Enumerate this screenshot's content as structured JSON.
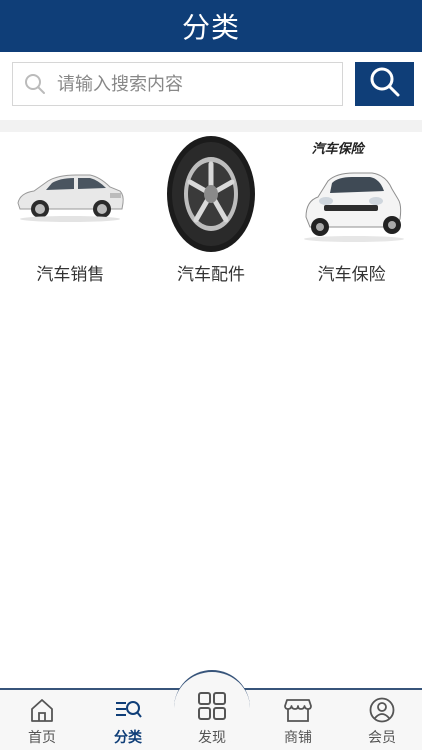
{
  "header": {
    "title": "分类"
  },
  "search": {
    "placeholder": "请输入搜索内容",
    "icon": "search-icon"
  },
  "categories": [
    {
      "label": "汽车销售",
      "icon": "sedan-car-image"
    },
    {
      "label": "汽车配件",
      "icon": "tire-image"
    },
    {
      "label": "汽车保险",
      "icon": "white-hatchback-image",
      "overlay_text": "汽车保险"
    }
  ],
  "tabbar": {
    "items": [
      {
        "label": "首页",
        "icon": "home-icon",
        "active": false
      },
      {
        "label": "分类",
        "icon": "category-list-icon",
        "active": true
      },
      {
        "label": "发现",
        "icon": "grid-icon",
        "active": false
      },
      {
        "label": "商铺",
        "icon": "shop-icon",
        "active": false
      },
      {
        "label": "会员",
        "icon": "user-icon",
        "active": false
      }
    ]
  },
  "colors": {
    "brand": "#0f3e78",
    "active_tab": "#0f3e78",
    "inactive_tab": "#555555"
  }
}
